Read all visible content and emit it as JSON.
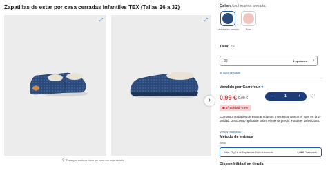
{
  "product": {
    "title": "Zapatillas de estar por casa cerradas Infantiles TEX (Tallas 26 a 32)"
  },
  "gallery": {
    "zoom_hint": "Pasa por encima el cursor para ver más detalle",
    "expand_icon": "expand-icon",
    "next_icon": "chevron-right-icon",
    "pages": 2,
    "current_page": 1
  },
  "color": {
    "label": "Color:",
    "value": "Azul marino armada",
    "options": [
      {
        "name": "Azul marino armada",
        "hex": "#2c4a7a",
        "selected": true
      },
      {
        "name": "Rosa",
        "hex": "#f2c6c0",
        "selected": false
      }
    ]
  },
  "size": {
    "label": "Talla:",
    "value": "29",
    "selected": "29",
    "options_text": "4 opciones",
    "guide_link": "Guía de tallas"
  },
  "seller": {
    "label": "Vendido por",
    "name": "Carrefour",
    "logo_icon": "carrefour-logo-icon"
  },
  "price": {
    "current": "0,99 €",
    "old": "9,99 €",
    "promo_badge": "2ª unidad -70%",
    "promo_text": "Compra 2 unidades de estos productos y te descontamos el 70% en la 2ª unidad. Descuento aplicable sobre el menor precio. Hasta el 18/09/2026.",
    "more_link": "Ver los productos",
    "color_red": "#e2353c"
  },
  "quantity": {
    "minus": "−",
    "value": "1",
    "plus": "+"
  },
  "delivery": {
    "title": "Método de entrega",
    "envio_label": "Envío",
    "window": "Entre 13 y 16 de Septiembre Envío a domicilio",
    "cost": "3,99 €",
    "cost_suffix": "Gestionado"
  },
  "store": {
    "title": "Disponibilidad en tienda"
  }
}
